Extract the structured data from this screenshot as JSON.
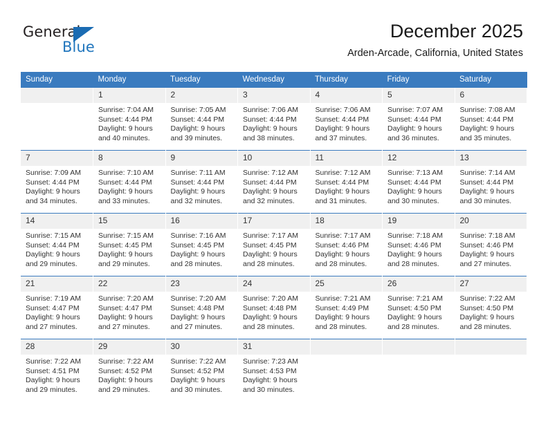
{
  "brand": {
    "name_part1": "General",
    "name_part2": "Blue",
    "triangle_color": "#1b6cb3"
  },
  "header": {
    "title": "December 2025",
    "subtitle": "Arden-Arcade, California, United States"
  },
  "theme": {
    "header_blue": "#3a7bbf",
    "daynum_band": "#f0f0f0",
    "text": "#333333"
  },
  "weekdays": [
    "Sunday",
    "Monday",
    "Tuesday",
    "Wednesday",
    "Thursday",
    "Friday",
    "Saturday"
  ],
  "labels": {
    "sunrise_prefix": "Sunrise:",
    "sunset_prefix": "Sunset:",
    "daylight_prefix": "Daylight:"
  },
  "weeks": [
    [
      {
        "day": "",
        "sunrise": "",
        "sunset": "",
        "daylight_line1": "",
        "daylight_line2": ""
      },
      {
        "day": "1",
        "sunrise": "Sunrise: 7:04 AM",
        "sunset": "Sunset: 4:44 PM",
        "daylight_line1": "Daylight: 9 hours",
        "daylight_line2": "and 40 minutes."
      },
      {
        "day": "2",
        "sunrise": "Sunrise: 7:05 AM",
        "sunset": "Sunset: 4:44 PM",
        "daylight_line1": "Daylight: 9 hours",
        "daylight_line2": "and 39 minutes."
      },
      {
        "day": "3",
        "sunrise": "Sunrise: 7:06 AM",
        "sunset": "Sunset: 4:44 PM",
        "daylight_line1": "Daylight: 9 hours",
        "daylight_line2": "and 38 minutes."
      },
      {
        "day": "4",
        "sunrise": "Sunrise: 7:06 AM",
        "sunset": "Sunset: 4:44 PM",
        "daylight_line1": "Daylight: 9 hours",
        "daylight_line2": "and 37 minutes."
      },
      {
        "day": "5",
        "sunrise": "Sunrise: 7:07 AM",
        "sunset": "Sunset: 4:44 PM",
        "daylight_line1": "Daylight: 9 hours",
        "daylight_line2": "and 36 minutes."
      },
      {
        "day": "6",
        "sunrise": "Sunrise: 7:08 AM",
        "sunset": "Sunset: 4:44 PM",
        "daylight_line1": "Daylight: 9 hours",
        "daylight_line2": "and 35 minutes."
      }
    ],
    [
      {
        "day": "7",
        "sunrise": "Sunrise: 7:09 AM",
        "sunset": "Sunset: 4:44 PM",
        "daylight_line1": "Daylight: 9 hours",
        "daylight_line2": "and 34 minutes."
      },
      {
        "day": "8",
        "sunrise": "Sunrise: 7:10 AM",
        "sunset": "Sunset: 4:44 PM",
        "daylight_line1": "Daylight: 9 hours",
        "daylight_line2": "and 33 minutes."
      },
      {
        "day": "9",
        "sunrise": "Sunrise: 7:11 AM",
        "sunset": "Sunset: 4:44 PM",
        "daylight_line1": "Daylight: 9 hours",
        "daylight_line2": "and 32 minutes."
      },
      {
        "day": "10",
        "sunrise": "Sunrise: 7:12 AM",
        "sunset": "Sunset: 4:44 PM",
        "daylight_line1": "Daylight: 9 hours",
        "daylight_line2": "and 32 minutes."
      },
      {
        "day": "11",
        "sunrise": "Sunrise: 7:12 AM",
        "sunset": "Sunset: 4:44 PM",
        "daylight_line1": "Daylight: 9 hours",
        "daylight_line2": "and 31 minutes."
      },
      {
        "day": "12",
        "sunrise": "Sunrise: 7:13 AM",
        "sunset": "Sunset: 4:44 PM",
        "daylight_line1": "Daylight: 9 hours",
        "daylight_line2": "and 30 minutes."
      },
      {
        "day": "13",
        "sunrise": "Sunrise: 7:14 AM",
        "sunset": "Sunset: 4:44 PM",
        "daylight_line1": "Daylight: 9 hours",
        "daylight_line2": "and 30 minutes."
      }
    ],
    [
      {
        "day": "14",
        "sunrise": "Sunrise: 7:15 AM",
        "sunset": "Sunset: 4:44 PM",
        "daylight_line1": "Daylight: 9 hours",
        "daylight_line2": "and 29 minutes."
      },
      {
        "day": "15",
        "sunrise": "Sunrise: 7:15 AM",
        "sunset": "Sunset: 4:45 PM",
        "daylight_line1": "Daylight: 9 hours",
        "daylight_line2": "and 29 minutes."
      },
      {
        "day": "16",
        "sunrise": "Sunrise: 7:16 AM",
        "sunset": "Sunset: 4:45 PM",
        "daylight_line1": "Daylight: 9 hours",
        "daylight_line2": "and 28 minutes."
      },
      {
        "day": "17",
        "sunrise": "Sunrise: 7:17 AM",
        "sunset": "Sunset: 4:45 PM",
        "daylight_line1": "Daylight: 9 hours",
        "daylight_line2": "and 28 minutes."
      },
      {
        "day": "18",
        "sunrise": "Sunrise: 7:17 AM",
        "sunset": "Sunset: 4:46 PM",
        "daylight_line1": "Daylight: 9 hours",
        "daylight_line2": "and 28 minutes."
      },
      {
        "day": "19",
        "sunrise": "Sunrise: 7:18 AM",
        "sunset": "Sunset: 4:46 PM",
        "daylight_line1": "Daylight: 9 hours",
        "daylight_line2": "and 28 minutes."
      },
      {
        "day": "20",
        "sunrise": "Sunrise: 7:18 AM",
        "sunset": "Sunset: 4:46 PM",
        "daylight_line1": "Daylight: 9 hours",
        "daylight_line2": "and 27 minutes."
      }
    ],
    [
      {
        "day": "21",
        "sunrise": "Sunrise: 7:19 AM",
        "sunset": "Sunset: 4:47 PM",
        "daylight_line1": "Daylight: 9 hours",
        "daylight_line2": "and 27 minutes."
      },
      {
        "day": "22",
        "sunrise": "Sunrise: 7:20 AM",
        "sunset": "Sunset: 4:47 PM",
        "daylight_line1": "Daylight: 9 hours",
        "daylight_line2": "and 27 minutes."
      },
      {
        "day": "23",
        "sunrise": "Sunrise: 7:20 AM",
        "sunset": "Sunset: 4:48 PM",
        "daylight_line1": "Daylight: 9 hours",
        "daylight_line2": "and 27 minutes."
      },
      {
        "day": "24",
        "sunrise": "Sunrise: 7:20 AM",
        "sunset": "Sunset: 4:48 PM",
        "daylight_line1": "Daylight: 9 hours",
        "daylight_line2": "and 28 minutes."
      },
      {
        "day": "25",
        "sunrise": "Sunrise: 7:21 AM",
        "sunset": "Sunset: 4:49 PM",
        "daylight_line1": "Daylight: 9 hours",
        "daylight_line2": "and 28 minutes."
      },
      {
        "day": "26",
        "sunrise": "Sunrise: 7:21 AM",
        "sunset": "Sunset: 4:50 PM",
        "daylight_line1": "Daylight: 9 hours",
        "daylight_line2": "and 28 minutes."
      },
      {
        "day": "27",
        "sunrise": "Sunrise: 7:22 AM",
        "sunset": "Sunset: 4:50 PM",
        "daylight_line1": "Daylight: 9 hours",
        "daylight_line2": "and 28 minutes."
      }
    ],
    [
      {
        "day": "28",
        "sunrise": "Sunrise: 7:22 AM",
        "sunset": "Sunset: 4:51 PM",
        "daylight_line1": "Daylight: 9 hours",
        "daylight_line2": "and 29 minutes."
      },
      {
        "day": "29",
        "sunrise": "Sunrise: 7:22 AM",
        "sunset": "Sunset: 4:52 PM",
        "daylight_line1": "Daylight: 9 hours",
        "daylight_line2": "and 29 minutes."
      },
      {
        "day": "30",
        "sunrise": "Sunrise: 7:22 AM",
        "sunset": "Sunset: 4:52 PM",
        "daylight_line1": "Daylight: 9 hours",
        "daylight_line2": "and 30 minutes."
      },
      {
        "day": "31",
        "sunrise": "Sunrise: 7:23 AM",
        "sunset": "Sunset: 4:53 PM",
        "daylight_line1": "Daylight: 9 hours",
        "daylight_line2": "and 30 minutes."
      },
      {
        "day": "",
        "sunrise": "",
        "sunset": "",
        "daylight_line1": "",
        "daylight_line2": ""
      },
      {
        "day": "",
        "sunrise": "",
        "sunset": "",
        "daylight_line1": "",
        "daylight_line2": ""
      },
      {
        "day": "",
        "sunrise": "",
        "sunset": "",
        "daylight_line1": "",
        "daylight_line2": ""
      }
    ]
  ]
}
